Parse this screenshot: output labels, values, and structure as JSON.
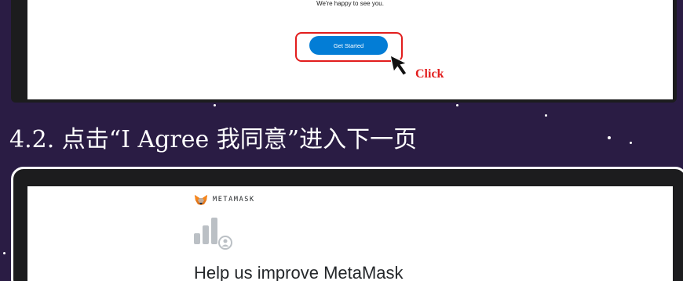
{
  "top_screen": {
    "tagline": "We're happy to see you.",
    "get_started_label": "Get Started",
    "click_annotation": "Click"
  },
  "step_heading": "4.2. 点击“I Agree 我同意”进入下一页",
  "bottom_screen": {
    "brand_name": "METAMASK",
    "heading": "Help us improve MetaMask"
  },
  "colors": {
    "background": "#2a1c44",
    "annotation_red": "#e21d1d",
    "button_blue": "#037dd6"
  },
  "icons": [
    "cursor-arrow-icon",
    "metamask-fox-icon",
    "analytics-bars-icon"
  ]
}
